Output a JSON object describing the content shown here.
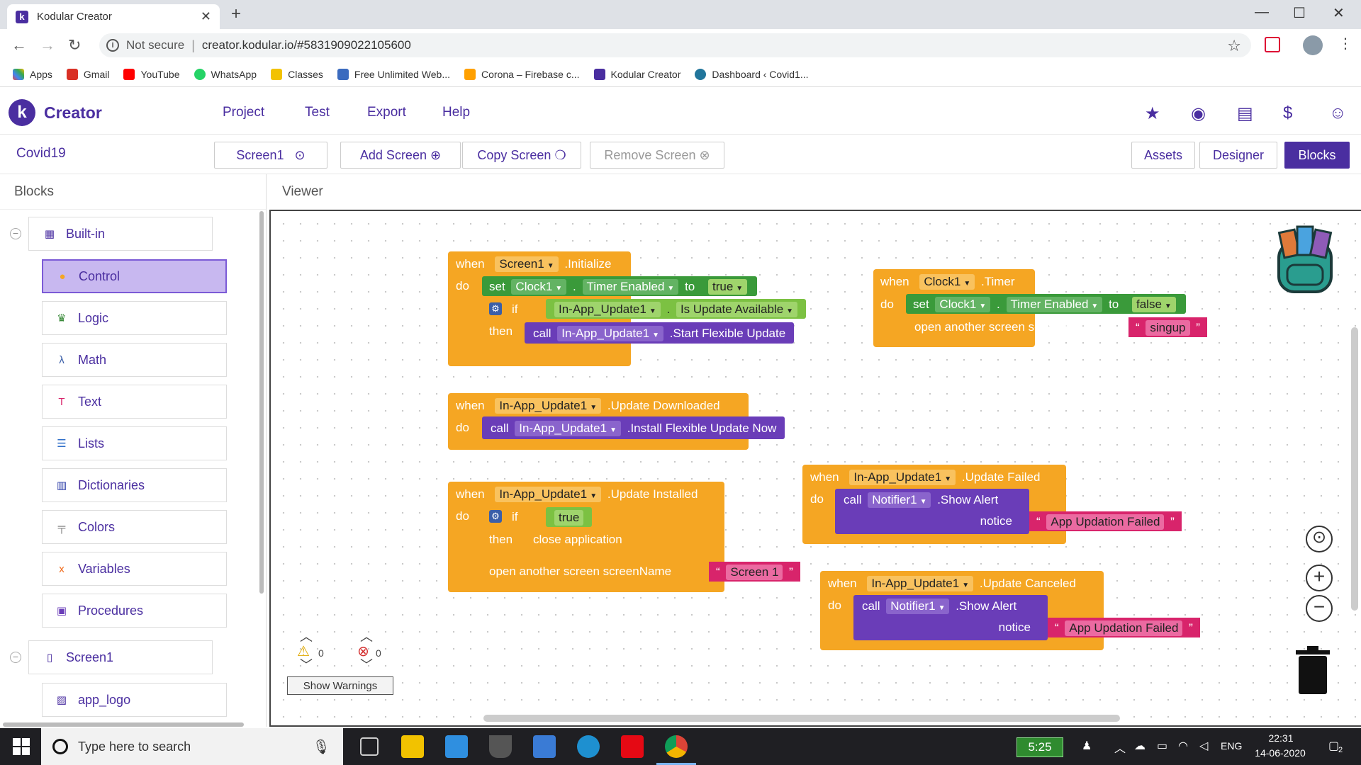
{
  "browser": {
    "tab_title": "Kodular Creator",
    "tab_close": "✕",
    "new_tab": "+",
    "win_min": "—",
    "win_max": "☐",
    "win_close": "✕",
    "back": "←",
    "forward": "→",
    "reload": "↻",
    "info": "i",
    "not_secure": "Not secure",
    "separator": "|",
    "url": "creator.kodular.io/#5831909022105600",
    "star": "☆",
    "menu": "⋮",
    "bookmarks": [
      {
        "label": "Apps",
        "color": "#e8453c"
      },
      {
        "label": "Gmail",
        "color": "#d93025"
      },
      {
        "label": "YouTube",
        "color": "#ff0000"
      },
      {
        "label": "WhatsApp",
        "color": "#25d366"
      },
      {
        "label": "Classes",
        "color": "#f2c200"
      },
      {
        "label": "Free Unlimited Web...",
        "color": "#3b6bbf"
      },
      {
        "label": "Corona – Firebase c...",
        "color": "#ffa000"
      },
      {
        "label": "Kodular Creator",
        "color": "#4a2ea0"
      },
      {
        "label": "Dashboard ‹ Covid1...",
        "color": "#21759b"
      }
    ]
  },
  "app": {
    "logo": "k",
    "brand": "Creator",
    "menu": [
      "Project",
      "Test",
      "Export",
      "Help"
    ],
    "header_icons": [
      "folder-star-icon",
      "palette-icon",
      "docs-icon",
      "dollar-icon",
      "account-icon"
    ],
    "project_name": "Covid19",
    "screen_select": "Screen1",
    "screen_select_icon": "⊙",
    "add_screen": "Add Screen",
    "add_icon": "⊕",
    "copy_screen": "Copy Screen",
    "copy_icon": "❍",
    "remove_screen": "Remove Screen",
    "remove_icon": "⊗",
    "assets": "Assets",
    "designer": "Designer",
    "blocks": "Blocks"
  },
  "panel": {
    "title": "Blocks",
    "collapse": "−",
    "builtin": "Built-in",
    "items": [
      "Control",
      "Logic",
      "Math",
      "Text",
      "Lists",
      "Dictionaries",
      "Colors",
      "Variables",
      "Procedures"
    ],
    "screen_root": "Screen1",
    "screen_items": [
      "app_logo"
    ]
  },
  "viewer": {
    "title": "Viewer",
    "warnings_count": "0",
    "errors_count": "0",
    "show_warnings": "Show Warnings",
    "zoom_in": "+",
    "zoom_out": "−",
    "recenter": "⊙",
    "blocks": {
      "b1": {
        "when": "when",
        "comp": "Screen1",
        "event": ".Initialize",
        "do": "do",
        "set": "set",
        "clock": "Clock1",
        "dot": ".",
        "prop": "Timer Enabled",
        "to": "to",
        "val": "true",
        "if": "if",
        "upd": "In-App_Update1",
        "avail": "Is Update Available",
        "then": "then",
        "call": "call",
        "method": ".Start Flexible Update"
      },
      "b2": {
        "when": "when",
        "comp": "Clock1",
        "event": ".Timer",
        "do": "do",
        "set": "set",
        "clock": "Clock1",
        "dot": ".",
        "prop": "Timer Enabled",
        "to": "to",
        "val": "false",
        "open": "open another screen  screenName",
        "screen": "singup"
      },
      "b3": {
        "when": "when",
        "comp": "In-App_Update1",
        "event": ".Update Downloaded",
        "do": "do",
        "call": "call",
        "method": ".Install Flexible Update Now"
      },
      "b4": {
        "when": "when",
        "comp": "In-App_Update1",
        "event": ".Update Installed",
        "do": "do",
        "if": "if",
        "val": "true",
        "then": "then",
        "close": "close application",
        "open": "open another screen  screenName",
        "screen": "Screen 1"
      },
      "b5": {
        "when": "when",
        "comp": "In-App_Update1",
        "event": ".Update Failed",
        "do": "do",
        "call": "call",
        "notifier": "Notifier1",
        "method": ".Show Alert",
        "notice": "notice",
        "msg": "App Updation Failed"
      },
      "b6": {
        "when": "when",
        "comp": "In-App_Update1",
        "event": ".Update Canceled",
        "do": "do",
        "call": "call",
        "notifier": "Notifier1",
        "method": ".Show Alert",
        "notice": "notice",
        "msg": "App Updation Failed"
      }
    }
  },
  "taskbar": {
    "search_placeholder": "Type here to search",
    "clock_badge": "5:25",
    "lang": "ENG",
    "time": "22:31",
    "date": "14-06-2020",
    "notifications": "2"
  },
  "colors": {
    "brand": "#4a2ea0",
    "event_block": "#f5a623",
    "set_block": "#3a9a3a",
    "logic_block": "#7cc142",
    "proc_block": "#6a3db8",
    "text_block": "#d8246b"
  }
}
